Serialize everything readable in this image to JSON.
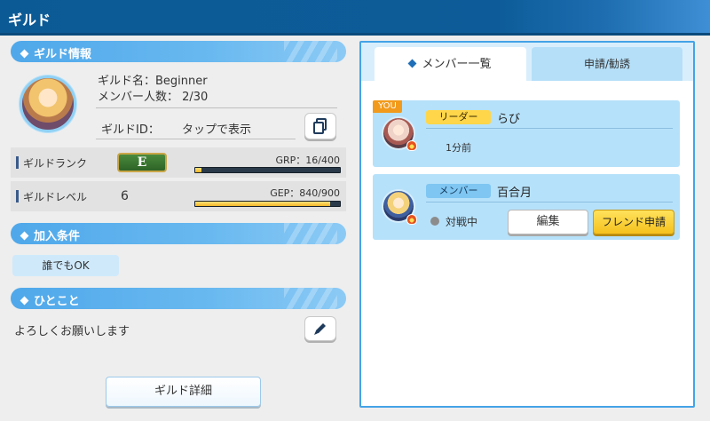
{
  "header": {
    "title": "ギルド"
  },
  "guild_info": {
    "section_title": "ギルド情報",
    "name_line": "ギルド名：Beginner",
    "members_line": "メンバー人数： 2/30",
    "id_label": "ギルドID：",
    "id_value": "タップで表示"
  },
  "stats": {
    "rank_label": "ギルドランク",
    "rank_value": "E",
    "grp_text": "GRP：16/400",
    "grp_progress": 0.04,
    "level_label": "ギルドレベル",
    "level_value": "6",
    "gep_text": "GEP：840/900",
    "gep_progress": 0.933
  },
  "conditions": {
    "section_title": "加入条件",
    "value": "誰でもOK"
  },
  "comment": {
    "section_title": "ひとこと",
    "text": "よろしくお願いします"
  },
  "guild_detail_button": "ギルド詳細",
  "tabs": {
    "members": "メンバー一覧",
    "requests": "申請/勧誘"
  },
  "members": [
    {
      "you_badge": "YOU",
      "role": "リーダー",
      "name": "らび",
      "last_active": "1分前"
    },
    {
      "role": "メンバー",
      "name": "百合月",
      "status": "対戦中",
      "edit_label": "編集",
      "friend_label": "フレンド申請"
    }
  ],
  "colors": {
    "title_bar": "#0d5c99",
    "accent_blue": "#4fa8ea",
    "leader_tag": "#ffd64a",
    "member_tag": "#7fc6f2",
    "friend_button": "#f5c11d",
    "you_badge": "#f29a1b"
  },
  "icons": {
    "copy": "copy-icon",
    "edit": "pencil-icon",
    "section": "diamond-icon"
  }
}
